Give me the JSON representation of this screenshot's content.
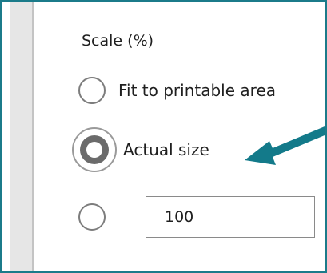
{
  "scale": {
    "title": "Scale (%)",
    "options": [
      {
        "label": "Fit to printable area",
        "selected": false
      },
      {
        "label": "Actual size",
        "selected": true
      },
      {
        "label": "",
        "selected": false
      }
    ],
    "custom_value": "100"
  },
  "colors": {
    "frame_border": "#1b7b8a",
    "annotation_arrow": "#137a8a",
    "radio_border": "#7d7d7d",
    "radio_selected": "#6b6b6b"
  },
  "icons": {
    "annotation": "arrow-icon"
  }
}
